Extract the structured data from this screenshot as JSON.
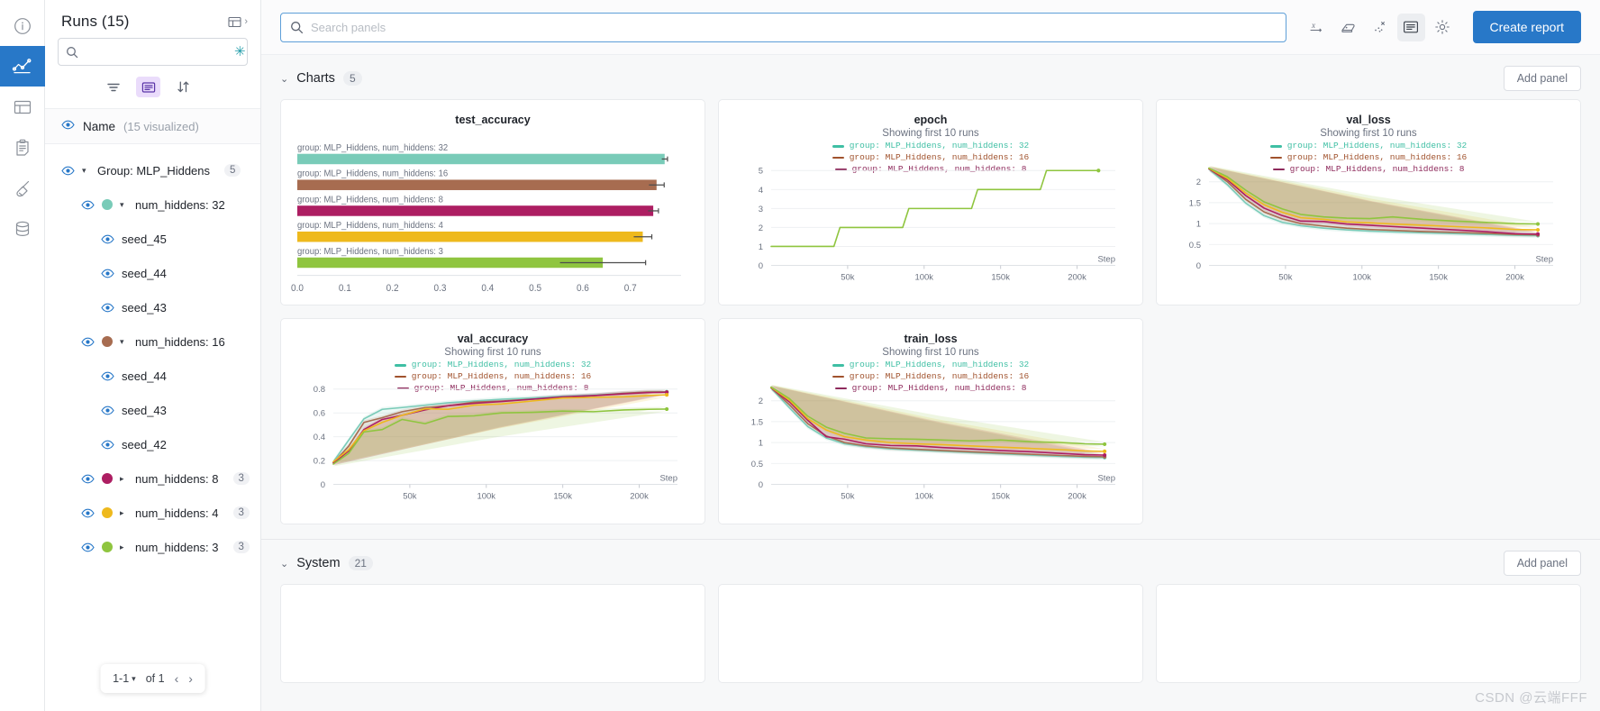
{
  "rail": {
    "items": [
      {
        "name": "info-icon",
        "label": "Info"
      },
      {
        "name": "chart-line-icon",
        "label": "Workspace",
        "active": true
      },
      {
        "name": "table-icon",
        "label": "Runs table"
      },
      {
        "name": "clipboard-icon",
        "label": "Reports"
      },
      {
        "name": "broom-icon",
        "label": "Sweeps"
      },
      {
        "name": "database-icon",
        "label": "Artifacts"
      }
    ]
  },
  "sidebar": {
    "title": "Runs (15)",
    "expand_label": "",
    "search": {
      "value": "",
      "placeholder": ""
    },
    "star_glyph": "✳",
    "tools": [
      {
        "name": "filter-icon",
        "label": "Filter",
        "active": false
      },
      {
        "name": "group-icon",
        "label": "Group",
        "active": true
      },
      {
        "name": "sort-icon",
        "label": "Sort",
        "active": false
      }
    ],
    "name_header": {
      "label": "Name",
      "sub": "(15 visualized)"
    },
    "tree": [
      {
        "level": 0,
        "label": "Group: MLP_Hiddens",
        "count": "5",
        "tri": "▾",
        "color": null
      },
      {
        "level": 1,
        "label": "num_hiddens: 32",
        "count": "",
        "tri": "▾",
        "color": "#79cbb8"
      },
      {
        "level": 2,
        "label": "seed_45",
        "count": "",
        "tri": "",
        "color": null
      },
      {
        "level": 2,
        "label": "seed_44",
        "count": "",
        "tri": "",
        "color": null
      },
      {
        "level": 2,
        "label": "seed_43",
        "count": "",
        "tri": "",
        "color": null
      },
      {
        "level": 1,
        "label": "num_hiddens: 16",
        "count": "",
        "tri": "▾",
        "color": "#a76c50"
      },
      {
        "level": 2,
        "label": "seed_44",
        "count": "",
        "tri": "",
        "color": null
      },
      {
        "level": 2,
        "label": "seed_43",
        "count": "",
        "tri": "",
        "color": null
      },
      {
        "level": 2,
        "label": "seed_42",
        "count": "",
        "tri": "",
        "color": null
      },
      {
        "level": 1,
        "label": "num_hiddens: 8",
        "count": "3",
        "tri": "▸",
        "color": "#ad1e62"
      },
      {
        "level": 1,
        "label": "num_hiddens: 4",
        "count": "3",
        "tri": "▸",
        "color": "#eeb91d"
      },
      {
        "level": 1,
        "label": "num_hiddens: 3",
        "count": "3",
        "tri": "▸",
        "color": "#8fc53f"
      }
    ],
    "pager": {
      "range": "1-1",
      "caret": "▾",
      "of": "of 1",
      "prev": "‹",
      "next": "›"
    }
  },
  "topbar": {
    "search": {
      "value": "",
      "placeholder": "Search panels"
    },
    "buttons": [
      {
        "name": "x-axis-icon",
        "label": "x axis",
        "active": false
      },
      {
        "name": "smoothing-icon",
        "label": "Smoothing",
        "active": false
      },
      {
        "name": "outliers-icon",
        "label": "Outliers",
        "active": false
      },
      {
        "name": "panel-layout-icon",
        "label": "Panel layout",
        "active": true
      },
      {
        "name": "gear-icon",
        "label": "Settings",
        "active": false
      }
    ],
    "create_report_label": "Create report"
  },
  "sections": [
    {
      "title": "Charts",
      "count": "5",
      "chevron": "⌄",
      "add_panel_label": "Add panel"
    },
    {
      "title": "System",
      "count": "21",
      "chevron": "⌄",
      "add_panel_label": "Add panel"
    }
  ],
  "watermark": "CSDN @云端FFF",
  "colors": {
    "accent": "#2878c8",
    "teal": "#79cbb8",
    "brown": "#a76c50",
    "magenta": "#ad1e62",
    "gold": "#eeb91d",
    "green": "#8fc53f",
    "err": "#4d4d4d"
  },
  "legend_common": {
    "sub": "Showing first 10 runs",
    "entries": [
      {
        "label": "group: MLP_Hiddens, num_hiddens: 32",
        "color": "#3fbfa4"
      },
      {
        "label": "group: MLP_Hiddens, num_hiddens: 16",
        "color": "#a0522d"
      },
      {
        "label": "group: MLP_Hiddens, num_hiddens: 8",
        "color": "#8e2a5c"
      }
    ]
  },
  "chart_data": [
    {
      "type": "bar",
      "title": "test_accuracy",
      "orientation": "horizontal",
      "xlabel": "",
      "ylabel": "",
      "xlim": [
        0.0,
        0.78
      ],
      "xticks": [
        "0.0",
        "0.1",
        "0.2",
        "0.3",
        "0.4",
        "0.5",
        "0.6",
        "0.7"
      ],
      "xtick_values": [
        0.0,
        0.1,
        0.2,
        0.3,
        0.4,
        0.5,
        0.6,
        0.7
      ],
      "grid": false,
      "categories": [
        "group: MLP_Hiddens, num_hiddens: 32",
        "group: MLP_Hiddens, num_hiddens: 16",
        "group: MLP_Hiddens, num_hiddens: 8",
        "group: MLP_Hiddens, num_hiddens: 4",
        "group: MLP_Hiddens, num_hiddens: 3"
      ],
      "values": [
        0.772,
        0.755,
        0.748,
        0.726,
        0.642
      ],
      "errors": [
        0.006,
        0.016,
        0.011,
        0.019,
        0.09
      ],
      "colors": [
        "#79cbb8",
        "#a76c50",
        "#ad1e62",
        "#eeb91d",
        "#8fc53f"
      ]
    },
    {
      "type": "line",
      "title": "epoch",
      "subtitle": "Showing first 10 runs",
      "xlabel": "Step",
      "ylabel": "",
      "xlim": [
        0,
        225000
      ],
      "ylim": [
        0,
        5.4
      ],
      "xticks": [
        "50k",
        "100k",
        "150k",
        "200k"
      ],
      "xtick_values": [
        50000,
        100000,
        150000,
        200000
      ],
      "yticks": [
        "0",
        "1",
        "2",
        "3",
        "4",
        "5"
      ],
      "ytick_values": [
        0,
        1,
        2,
        3,
        4,
        5
      ],
      "grid": true,
      "series": [
        {
          "name": "group: MLP_Hiddens, num_hiddens: 3",
          "color": "#8fc53f",
          "x": [
            0,
            41000,
            45000,
            86000,
            90000,
            131000,
            135000,
            176000,
            180000,
            214000
          ],
          "y": [
            1,
            1,
            2,
            2,
            3,
            3,
            4,
            4,
            5,
            5
          ]
        }
      ]
    },
    {
      "type": "line",
      "title": "val_loss",
      "subtitle": "Showing first 10 runs",
      "xlabel": "Step",
      "ylabel": "",
      "xlim": [
        0,
        225000
      ],
      "ylim": [
        0,
        2.45
      ],
      "xticks": [
        "50k",
        "100k",
        "150k",
        "200k"
      ],
      "xtick_values": [
        50000,
        100000,
        150000,
        200000
      ],
      "yticks": [
        "0",
        "0.5",
        "1",
        "1.5",
        "2"
      ],
      "ytick_values": [
        0,
        0.5,
        1,
        1.5,
        2
      ],
      "grid": true,
      "x": [
        0,
        12000,
        24000,
        36000,
        48000,
        60000,
        75000,
        90000,
        105000,
        120000,
        140000,
        160000,
        180000,
        200000,
        215000
      ],
      "series": [
        {
          "name": "num_hiddens: 32",
          "color": "#79cbb8",
          "y": [
            2.3,
            1.93,
            1.49,
            1.19,
            1.03,
            0.95,
            0.89,
            0.85,
            0.82,
            0.8,
            0.78,
            0.76,
            0.74,
            0.72,
            0.71
          ]
        },
        {
          "name": "num_hiddens: 16",
          "color": "#a76c50",
          "y": [
            2.31,
            2.0,
            1.58,
            1.28,
            1.11,
            1.0,
            0.94,
            0.89,
            0.86,
            0.84,
            0.81,
            0.79,
            0.77,
            0.74,
            0.73
          ]
        },
        {
          "name": "num_hiddens: 8",
          "color": "#ad1e62",
          "y": [
            2.31,
            2.05,
            1.67,
            1.37,
            1.19,
            1.06,
            1.05,
            0.99,
            0.96,
            0.93,
            0.89,
            0.85,
            0.81,
            0.76,
            0.75
          ]
        },
        {
          "name": "num_hiddens: 4",
          "color": "#eeb91d",
          "y": [
            2.32,
            2.08,
            1.73,
            1.45,
            1.27,
            1.14,
            1.1,
            1.04,
            1.02,
            0.99,
            0.96,
            0.93,
            0.9,
            0.86,
            0.85
          ]
        },
        {
          "name": "num_hiddens: 3",
          "color": "#8fc53f",
          "y": [
            2.33,
            2.12,
            1.8,
            1.52,
            1.35,
            1.22,
            1.16,
            1.13,
            1.12,
            1.16,
            1.1,
            1.06,
            1.03,
            1.0,
            0.99
          ]
        }
      ]
    },
    {
      "type": "line",
      "title": "val_accuracy",
      "subtitle": "Showing first 10 runs",
      "xlabel": "Step",
      "ylabel": "",
      "xlim": [
        0,
        225000
      ],
      "ylim": [
        0,
        0.86
      ],
      "xticks": [
        "50k",
        "100k",
        "150k",
        "200k"
      ],
      "xtick_values": [
        50000,
        100000,
        150000,
        200000
      ],
      "yticks": [
        "0",
        "0.2",
        "0.4",
        "0.6",
        "0.8"
      ],
      "ytick_values": [
        0,
        0.2,
        0.4,
        0.6,
        0.8
      ],
      "grid": true,
      "x": [
        0,
        10000,
        20000,
        32000,
        45000,
        60000,
        75000,
        92000,
        110000,
        130000,
        150000,
        170000,
        190000,
        205000,
        218000
      ],
      "series": [
        {
          "name": "num_hiddens: 32",
          "color": "#79cbb8",
          "y": [
            0.19,
            0.37,
            0.55,
            0.63,
            0.645,
            0.665,
            0.685,
            0.7,
            0.715,
            0.725,
            0.74,
            0.75,
            0.765,
            0.775,
            0.778
          ]
        },
        {
          "name": "num_hiddens: 16",
          "color": "#a76c50",
          "y": [
            0.18,
            0.32,
            0.52,
            0.56,
            0.61,
            0.645,
            0.66,
            0.69,
            0.7,
            0.715,
            0.73,
            0.745,
            0.765,
            0.775,
            0.776
          ]
        },
        {
          "name": "num_hiddens: 8",
          "color": "#ad1e62",
          "y": [
            0.18,
            0.28,
            0.46,
            0.545,
            0.58,
            0.625,
            0.66,
            0.68,
            0.695,
            0.715,
            0.735,
            0.745,
            0.76,
            0.77,
            0.772
          ]
        },
        {
          "name": "num_hiddens: 4",
          "color": "#eeb91d",
          "y": [
            0.19,
            0.29,
            0.45,
            0.52,
            0.58,
            0.635,
            0.63,
            0.665,
            0.675,
            0.7,
            0.725,
            0.73,
            0.735,
            0.745,
            0.752
          ]
        },
        {
          "name": "num_hiddens: 3",
          "color": "#8fc53f",
          "y": [
            0.17,
            0.26,
            0.44,
            0.46,
            0.545,
            0.51,
            0.57,
            0.575,
            0.6,
            0.605,
            0.615,
            0.61,
            0.625,
            0.63,
            0.632
          ]
        }
      ]
    },
    {
      "type": "line",
      "title": "train_loss",
      "subtitle": "Showing first 10 runs",
      "xlabel": "Step",
      "ylabel": "",
      "xlim": [
        0,
        225000
      ],
      "ylim": [
        0,
        2.45
      ],
      "xticks": [
        "50k",
        "100k",
        "150k",
        "200k"
      ],
      "xtick_values": [
        50000,
        100000,
        150000,
        200000
      ],
      "yticks": [
        "0",
        "0.5",
        "1",
        "1.5",
        "2"
      ],
      "ytick_values": [
        0,
        0.5,
        1,
        1.5,
        2
      ],
      "grid": true,
      "x": [
        0,
        12000,
        24000,
        36000,
        48000,
        62000,
        78000,
        95000,
        112000,
        130000,
        150000,
        170000,
        190000,
        205000,
        218000
      ],
      "series": [
        {
          "name": "num_hiddens: 32",
          "color": "#79cbb8",
          "y": [
            2.3,
            1.83,
            1.38,
            1.11,
            0.97,
            0.9,
            0.85,
            0.82,
            0.79,
            0.76,
            0.73,
            0.7,
            0.67,
            0.65,
            0.64
          ]
        },
        {
          "name": "num_hiddens: 16",
          "color": "#a76c50",
          "y": [
            2.31,
            1.9,
            1.45,
            1.16,
            1.0,
            0.92,
            0.87,
            0.84,
            0.81,
            0.78,
            0.75,
            0.72,
            0.69,
            0.67,
            0.66
          ]
        },
        {
          "name": "num_hiddens: 8",
          "color": "#ad1e62",
          "y": [
            2.31,
            1.97,
            1.53,
            1.14,
            1.08,
            0.97,
            0.93,
            0.92,
            0.88,
            0.85,
            0.81,
            0.78,
            0.74,
            0.71,
            0.7
          ]
        },
        {
          "name": "num_hiddens: 4",
          "color": "#eeb91d",
          "y": [
            2.32,
            2.01,
            1.57,
            1.3,
            1.14,
            1.06,
            1.0,
            0.97,
            0.95,
            0.92,
            0.89,
            0.86,
            0.83,
            0.8,
            0.79
          ]
        },
        {
          "name": "num_hiddens: 3",
          "color": "#8fc53f",
          "y": [
            2.33,
            2.05,
            1.63,
            1.37,
            1.22,
            1.11,
            1.09,
            1.08,
            1.06,
            1.04,
            1.06,
            1.02,
            1.0,
            0.97,
            0.96
          ]
        }
      ]
    }
  ]
}
